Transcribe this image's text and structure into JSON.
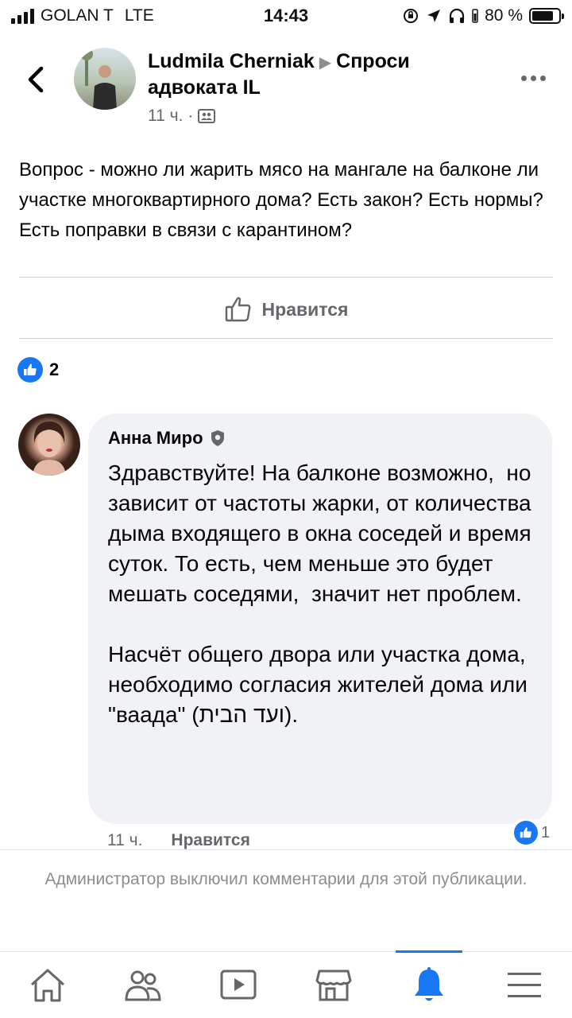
{
  "status_bar": {
    "carrier": "GOLAN T",
    "network": "LTE",
    "time": "14:43",
    "battery": "80 %"
  },
  "header": {
    "author": "Ludmila Cherniak",
    "group": "Спроси адвоката IL",
    "time": "11 ч.",
    "separator": "·"
  },
  "post": {
    "text": "Вопрос - можно ли жарить мясо на мангале на балконе ли участке многоквартирного дома? Есть закон? Есть нормы? Есть поправки в связи с карантином?",
    "like_label": "Нравится",
    "reaction_count": "2"
  },
  "comment": {
    "author": "Анна Миро",
    "text": "Здравствуйте! На балконе возможно,  но зависит от частоты жарки, от количества дыма входящего в окна соседей и время суток. То есть, чем меньше это будет мешать соседями,  значит нет проблем.\n\nНасчёт общего двора или участка дома, необходимо согласия жителей дома или \"ваада\" (ועד הבית).",
    "time": "11 ч.",
    "like_label": "Нравится",
    "reaction_count": "1"
  },
  "comments_disabled_notice": "Администратор выключил комментарии для этой публикации.",
  "tab_bar": {
    "tabs": [
      "home-icon",
      "groups-icon",
      "watch-icon",
      "marketplace-icon",
      "notifications-icon",
      "menu-icon"
    ],
    "active": "notifications-icon"
  },
  "colors": {
    "accent": "#1877f2",
    "secondary_text": "#65676b",
    "bubble": "#f0f2f5"
  }
}
